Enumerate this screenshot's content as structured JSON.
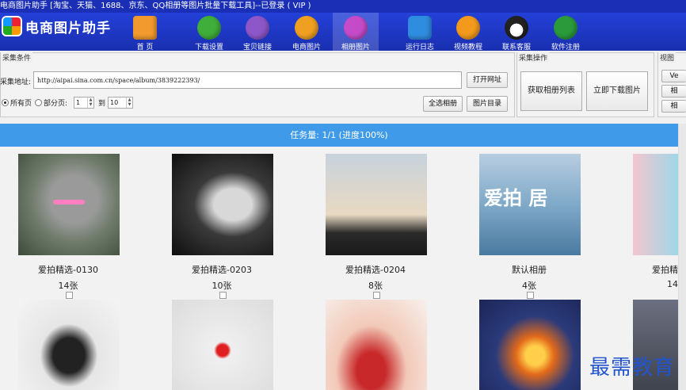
{
  "window": {
    "title": "电商图片助手 [淘宝、天猫、1688、京东、QQ相册等图片批量下载工具]--已登录 ( VIP )"
  },
  "app": {
    "name": "电商图片助手"
  },
  "toolbar": {
    "items": [
      {
        "label": "首 页",
        "icon": "home-icon",
        "color": "#f29a2e"
      },
      {
        "label": "下载设置",
        "icon": "gear-icon",
        "color": "#3fae3a"
      },
      {
        "label": "宝贝链接",
        "icon": "link-icon",
        "color": "#8e57c9"
      },
      {
        "label": "电商图片",
        "icon": "cart-icon",
        "color": "#f0a020"
      },
      {
        "label": "相册图片",
        "icon": "globe-icon",
        "color": "#c64bc9"
      },
      {
        "label": "运行日志",
        "icon": "log-icon",
        "color": "#2f8de0"
      },
      {
        "label": "视频教程",
        "icon": "play-icon",
        "color": "#f39a1c"
      },
      {
        "label": "联系客服",
        "icon": "penguin-icon",
        "color": "#222222"
      },
      {
        "label": "软件注册",
        "icon": "user-icon",
        "color": "#2a9a3a"
      }
    ]
  },
  "collect": {
    "legend": "采集条件",
    "url_label": "采集地址:",
    "url_value": "http://aipai.sina.com.cn/space/album/3839222393/",
    "open_button": "打开网址",
    "radio_all": "所有页",
    "radio_part": "部分页:",
    "page_from": "1",
    "page_to_label": "到",
    "page_to": "10",
    "select_all_button": "全选相册",
    "image_dir_button": "图片目录"
  },
  "actions": {
    "legend": "采集操作",
    "get_albums_button": "获取相册列表",
    "download_button": "立即下载图片"
  },
  "view": {
    "legend": "视图",
    "buttons": [
      "Ve",
      "相",
      "相"
    ]
  },
  "status": {
    "text": "任务量: 1/1 (进度100%)"
  },
  "albums": [
    {
      "name": "爱拍精选-0130",
      "count": "14张"
    },
    {
      "name": "爱拍精选-0203",
      "count": "10张"
    },
    {
      "name": "爱拍精选-0204",
      "count": "8张"
    },
    {
      "name": "默认相册",
      "count": "4张"
    },
    {
      "name": "爱拍精",
      "count": "14"
    }
  ],
  "thumb_text": {
    "album3": "爱拍 居"
  },
  "watermark": "最需教育"
}
